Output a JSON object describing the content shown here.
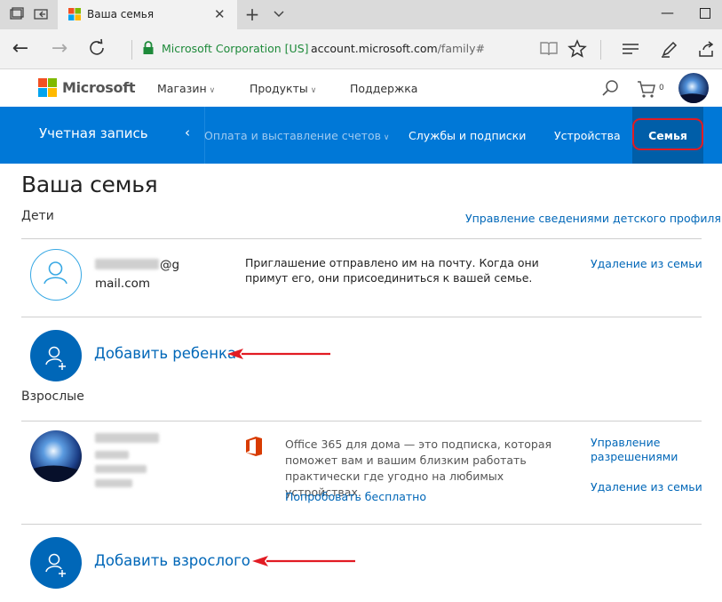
{
  "browser": {
    "tab_title": "Ваша семья",
    "cert_name": "Microsoft Corporation [US]",
    "url_host": "account.microsoft.com",
    "url_path": "/family#"
  },
  "header": {
    "brand": "Microsoft",
    "nav": [
      "Магазин",
      "Продукты",
      "Поддержка"
    ],
    "cart_count": "0"
  },
  "account_nav": {
    "title": "Учетная запись",
    "items": [
      "Оплата и выставление счетов",
      "Службы и подписки",
      "Устройства"
    ],
    "active": "Семья"
  },
  "page": {
    "title": "Ваша семья",
    "children_heading": "Дети",
    "manage_child_link": "Управление сведениями детского профиля",
    "child": {
      "email_suffix": "@g",
      "email_line2": "mail.com",
      "message": "Приглашение отправлено им на почту. Когда они примут его, они присоединиться к вашей семье.",
      "remove_link": "Удаление из семьи"
    },
    "add_child": "Добавить ребенка",
    "adults_heading": "Взрослые",
    "adult": {
      "office_text": "Office 365 для дома — это подписка, которая поможет вам и вашим близким работать практически где угодно на любимых устройствах.",
      "try_link": "Попробовать бесплатно",
      "manage_link": "Управление разрешениями",
      "remove_link": "Удаление из семьи"
    },
    "add_adult": "Добавить взрослого"
  },
  "colors": {
    "accent_blue": "#0078d7",
    "link_blue": "#0067b8",
    "highlight_red": "#e21b23"
  }
}
